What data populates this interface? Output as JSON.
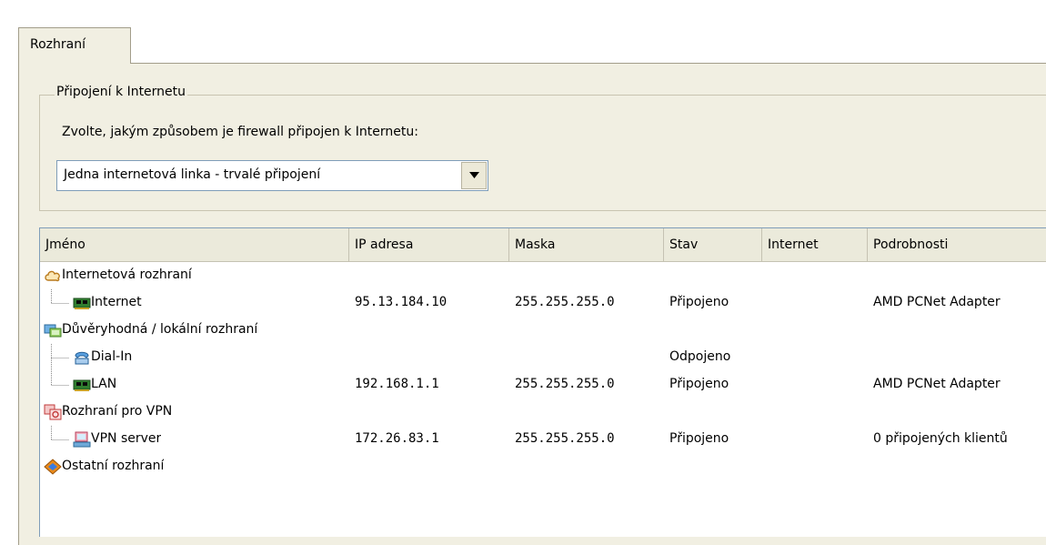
{
  "tabs": [
    {
      "label": "Rozhraní"
    }
  ],
  "connection": {
    "group_title": "Připojení k Internetu",
    "prompt": "Zvolte, jakým způsobem je firewall připojen k Internetu:",
    "mode_value": "Jedna internetová linka - trvalé připojení"
  },
  "table": {
    "columns": [
      "Jméno",
      "IP adresa",
      "Maska",
      "Stav",
      "Internet",
      "Podrobnosti"
    ],
    "rows": [
      {
        "name": "Internetová rozhraní",
        "icon": "cloud-icon",
        "ip": "",
        "mask": "",
        "status": "",
        "internet": "",
        "details": ""
      },
      {
        "name": "Internet",
        "icon": "network-card-icon",
        "ip": "95.13.184.10",
        "mask": "255.255.255.0",
        "status": "Připojeno",
        "internet": "",
        "details": "AMD PCNet Adapter"
      },
      {
        "name": "Důvěryhodná / lokální rozhraní",
        "icon": "computers-icon",
        "ip": "",
        "mask": "",
        "status": "",
        "internet": "",
        "details": ""
      },
      {
        "name": "Dial-In",
        "icon": "modem-icon",
        "ip": "",
        "mask": "",
        "status": "Odpojeno",
        "internet": "",
        "details": ""
      },
      {
        "name": "LAN",
        "icon": "network-card-icon",
        "ip": "192.168.1.1",
        "mask": "255.255.255.0",
        "status": "Připojeno",
        "internet": "",
        "details": "AMD PCNet Adapter"
      },
      {
        "name": "Rozhraní pro VPN",
        "icon": "vpn-group-icon",
        "ip": "",
        "mask": "",
        "status": "",
        "internet": "",
        "details": ""
      },
      {
        "name": "VPN server",
        "icon": "vpn-server-icon",
        "ip": "172.26.83.1",
        "mask": "255.255.255.0",
        "status": "Připojeno",
        "internet": "",
        "details": "0 připojených klientů"
      },
      {
        "name": "Ostatní rozhraní",
        "icon": "other-interfaces-icon",
        "ip": "",
        "mask": "",
        "status": "",
        "internet": "",
        "details": ""
      }
    ]
  }
}
